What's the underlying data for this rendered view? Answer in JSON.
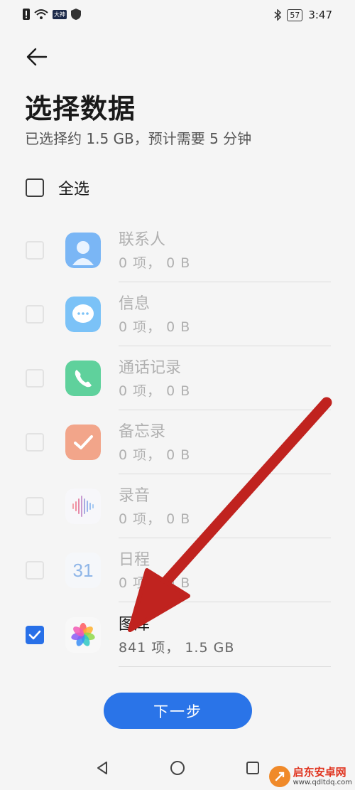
{
  "status_bar": {
    "time": "3:47",
    "battery": "57",
    "carrier_badge": "大神"
  },
  "header": {
    "title": "选择数据",
    "subtitle": "已选择约 1.5 GB，预计需要 5 分钟"
  },
  "select_all": {
    "label": "全选",
    "checked": false
  },
  "items": [
    {
      "name": "联系人",
      "meta": "0 项， 0 B",
      "icon": "contacts-icon",
      "checked": false
    },
    {
      "name": "信息",
      "meta": "0 项， 0 B",
      "icon": "messages-icon",
      "checked": false
    },
    {
      "name": "通话记录",
      "meta": "0 项， 0 B",
      "icon": "phone-icon",
      "checked": false
    },
    {
      "name": "备忘录",
      "meta": "0 项， 0 B",
      "icon": "notes-icon",
      "checked": false
    },
    {
      "name": "录音",
      "meta": "0 项， 0 B",
      "icon": "recorder-icon",
      "checked": false
    },
    {
      "name": "日程",
      "meta": "0 项， 0 B",
      "icon": "calendar-icon",
      "calendar_day": "31",
      "checked": false
    },
    {
      "name": "图库",
      "meta": "841 项， 1.5 GB",
      "icon": "gallery-icon",
      "checked": true
    }
  ],
  "next_button": {
    "label": "下一步"
  },
  "watermark": {
    "title": "启东安卓网",
    "url": "www.qdltdq.com"
  },
  "colors": {
    "accent": "#2a74e8",
    "annotation_arrow": "#c0231f"
  }
}
